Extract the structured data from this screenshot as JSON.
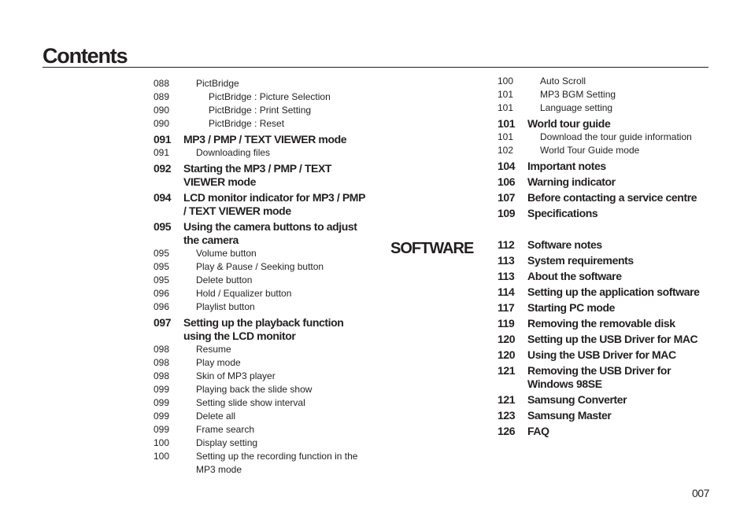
{
  "page": {
    "title": "Contents",
    "page_number": "007",
    "section_label": "SOFTWARE"
  },
  "left_column": [
    {
      "num": "088",
      "text": "PictBridge",
      "level": "sub"
    },
    {
      "num": "089",
      "text": "PictBridge : Picture Selection",
      "level": "deep"
    },
    {
      "num": "090",
      "text": "PictBridge : Print Setting",
      "level": "deep"
    },
    {
      "num": "090",
      "text": "PictBridge : Reset",
      "level": "deep"
    },
    {
      "num": "091",
      "text": "MP3 / PMP / TEXT VIEWER mode",
      "level": "main"
    },
    {
      "num": "091",
      "text": "Downloading files",
      "level": "sub"
    },
    {
      "num": "092",
      "text": "Starting the MP3 / PMP / TEXT VIEWER mode",
      "level": "main"
    },
    {
      "num": "094",
      "text": "LCD monitor indicator for MP3 / PMP / TEXT VIEWER mode",
      "level": "main"
    },
    {
      "num": "095",
      "text": "Using the camera buttons to adjust the camera",
      "level": "main"
    },
    {
      "num": "095",
      "text": "Volume button",
      "level": "sub"
    },
    {
      "num": "095",
      "text": "Play & Pause / Seeking button",
      "level": "sub"
    },
    {
      "num": "095",
      "text": "Delete button",
      "level": "sub"
    },
    {
      "num": "096",
      "text": "Hold / Equalizer button",
      "level": "sub"
    },
    {
      "num": "096",
      "text": "Playlist button",
      "level": "sub"
    },
    {
      "num": "097",
      "text": "Setting up the playback function using the LCD monitor",
      "level": "main"
    },
    {
      "num": "098",
      "text": "Resume",
      "level": "sub"
    },
    {
      "num": "098",
      "text": "Play mode",
      "level": "sub"
    },
    {
      "num": "098",
      "text": "Skin of MP3 player",
      "level": "sub"
    },
    {
      "num": "099",
      "text": "Playing back the slide show",
      "level": "sub"
    },
    {
      "num": "099",
      "text": "Setting slide show interval",
      "level": "sub"
    },
    {
      "num": "099",
      "text": "Delete all",
      "level": "sub"
    },
    {
      "num": "099",
      "text": "Frame search",
      "level": "sub"
    },
    {
      "num": "100",
      "text": "Display setting",
      "level": "sub"
    },
    {
      "num": "100",
      "text": "Setting up the recording function in the MP3 mode",
      "level": "sub"
    }
  ],
  "right_column": [
    {
      "num": "100",
      "text": "Auto Scroll",
      "level": "sub"
    },
    {
      "num": "101",
      "text": "MP3 BGM Setting",
      "level": "sub"
    },
    {
      "num": "101",
      "text": "Language setting",
      "level": "sub"
    },
    {
      "num": "101",
      "text": "World tour guide",
      "level": "main"
    },
    {
      "num": "101",
      "text": "Download the tour guide information",
      "level": "sub"
    },
    {
      "num": "102",
      "text": "World Tour Guide mode",
      "level": "sub"
    },
    {
      "num": "104",
      "text": "Important notes",
      "level": "main"
    },
    {
      "num": "106",
      "text": "Warning indicator",
      "level": "main"
    },
    {
      "num": "107",
      "text": "Before contacting a service centre",
      "level": "main"
    },
    {
      "num": "109",
      "text": "Specifications",
      "level": "main"
    }
  ],
  "software_column": [
    {
      "num": "112",
      "text": "Software notes",
      "level": "main"
    },
    {
      "num": "113",
      "text": "System requirements",
      "level": "main"
    },
    {
      "num": "113",
      "text": "About the software",
      "level": "main"
    },
    {
      "num": "114",
      "text": "Setting up the application software",
      "level": "main"
    },
    {
      "num": "117",
      "text": "Starting PC mode",
      "level": "main"
    },
    {
      "num": "119",
      "text": "Removing the removable disk",
      "level": "main"
    },
    {
      "num": "120",
      "text": "Setting up the USB Driver for MAC",
      "level": "main"
    },
    {
      "num": "120",
      "text": "Using the USB Driver for MAC",
      "level": "main"
    },
    {
      "num": "121",
      "text": "Removing the USB Driver for Windows 98SE",
      "level": "main"
    },
    {
      "num": "121",
      "text": "Samsung Converter",
      "level": "main"
    },
    {
      "num": "123",
      "text": "Samsung Master",
      "level": "main"
    },
    {
      "num": "126",
      "text": "FAQ",
      "level": "main"
    }
  ]
}
